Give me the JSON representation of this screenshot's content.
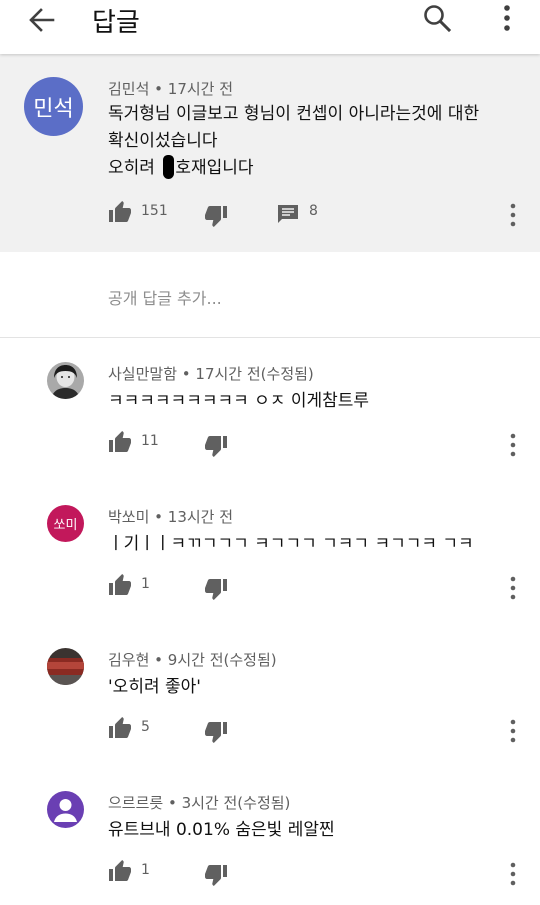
{
  "header": {
    "title": "답글"
  },
  "comment": {
    "avatar_text": "민석",
    "author": "김민석",
    "time": "17시간 전",
    "line1": "독거형님 이글보고 형님이 컨셉이 아니라는것에 대한",
    "line2": "확신이섰습니다",
    "line3_before": "오히려 ",
    "line3_after": "호재입니다",
    "likes": "151",
    "replies": "8",
    "colors": {
      "avatar": "#5b6ec7",
      "background": "#f1f1f1"
    }
  },
  "add_reply": {
    "placeholder": "공개 답글 추가..."
  },
  "replies": [
    {
      "author": "사실만말함",
      "time": "17시간 전(수정됨)",
      "text": "ㅋㅋㅋㅋㅋㅋㅋㅋㅋ ㅇㅈ 이게참트루",
      "likes": "11",
      "avatar_icon": "portrait-photo-icon"
    },
    {
      "author": "박쏘미",
      "time": "13시간 전",
      "text": "ㅣ기ㅣㅣㅋㄲㄱㄱㄱ ㅋㄱㄱㄱ ㄱㅋㄱ ㅋㄱㄱㅋ ㄱㅋ",
      "likes": "1",
      "avatar_text": "쏘미",
      "avatar_color": "#c2185b"
    },
    {
      "author": "김우현",
      "time": "9시간 전(수정됨)",
      "text": "'오히려 좋아'",
      "likes": "5",
      "avatar_icon": "red-object-photo-icon"
    },
    {
      "author": "으르르릇",
      "time": "3시간 전(수정됨)",
      "text": "유트브내  0.01%  숨은빛  레알찐",
      "likes": "1",
      "avatar_icon": "default-person-icon",
      "avatar_color": "#6a3fb3"
    }
  ],
  "separator": " • "
}
